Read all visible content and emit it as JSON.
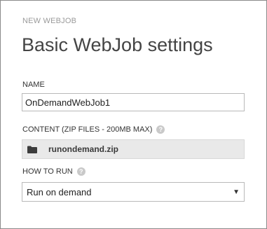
{
  "dialog": {
    "kicker": "NEW WEBJOB",
    "title": "Basic WebJob settings"
  },
  "name_field": {
    "label": "NAME",
    "value": "OnDemandWebJob1"
  },
  "content_field": {
    "label": "CONTENT (ZIP FILES - 200MB MAX)",
    "file_name": "runondemand.zip"
  },
  "how_to_run_field": {
    "label": "HOW TO RUN",
    "selected": "Run on demand"
  },
  "help_glyph": "?",
  "caret_glyph": "▼"
}
